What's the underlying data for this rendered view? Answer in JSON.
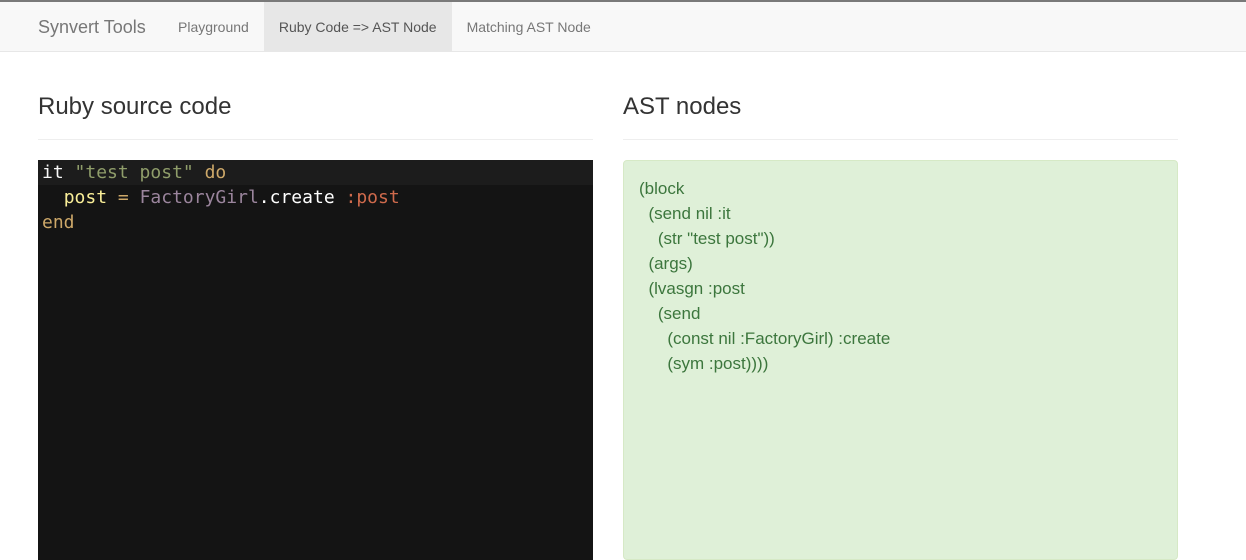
{
  "navbar": {
    "brand": "Synvert Tools",
    "items": [
      {
        "label": "Playground",
        "active": false
      },
      {
        "label": "Ruby Code => AST Node",
        "active": true
      },
      {
        "label": "Matching AST Node",
        "active": false
      }
    ]
  },
  "left_panel": {
    "title": "Ruby source code",
    "code": {
      "line1": {
        "t1": "it",
        "t2": " ",
        "t3": "\"test post\"",
        "t4": " ",
        "t5": "do"
      },
      "line2": {
        "t1": "  ",
        "t2": "post",
        "t3": " ",
        "t4": "=",
        "t5": " ",
        "t6": "FactoryGirl",
        "t7": ".create",
        "t8": " ",
        "t9": ":post"
      },
      "line3": {
        "t1": "end"
      }
    }
  },
  "right_panel": {
    "title": "AST nodes",
    "lines": [
      "(block",
      "  (send nil :it",
      "    (str \"test post\"))",
      "  (args)",
      "  (lvasgn :post",
      "    (send",
      "      (const nil :FactoryGirl) :create",
      "      (sym :post))))"
    ]
  },
  "colors": {
    "editor_bg": "#141414",
    "ast_bg": "#dff0d8",
    "ast_text": "#3c763d",
    "navbar_bg": "#f8f8f8",
    "nav_active_bg": "#e7e7e7"
  }
}
